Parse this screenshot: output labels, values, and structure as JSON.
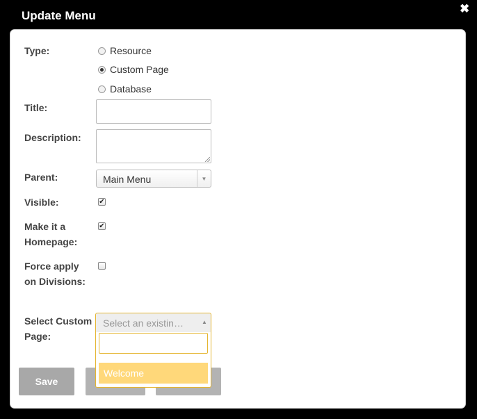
{
  "dialog": {
    "title": "Update Menu",
    "close_glyph": "✖"
  },
  "form": {
    "type_label": "Type:",
    "type_options": [
      "Resource",
      "Custom Page",
      "Database"
    ],
    "type_selected": "Custom Page",
    "title_label": "Title:",
    "title_value": "",
    "description_label": "Description:",
    "description_value": "",
    "parent_label": "Parent:",
    "parent_value": "Main Menu",
    "visible_label": "Visible:",
    "visible_checked": true,
    "homepage_label": "Make it a Homepage:",
    "homepage_checked": true,
    "force_label": "Force apply on Divisions:",
    "force_checked": false,
    "custom_page_label": "Select Custom Page:",
    "custom_page_placeholder": "Select an existin…",
    "custom_page_search": "",
    "custom_page_options": [
      "Welcome"
    ]
  },
  "buttons": {
    "save_label": "Save"
  },
  "colors": {
    "background": "#000000",
    "panel": "#ffffff",
    "focus_border": "#e5b530",
    "option_highlight": "#ffd87a",
    "button_grey": "#a8a8a8"
  },
  "icons": {
    "close": "close-icon",
    "dropdown": "chevron-down-icon",
    "dropdown_open": "chevron-up-icon"
  }
}
